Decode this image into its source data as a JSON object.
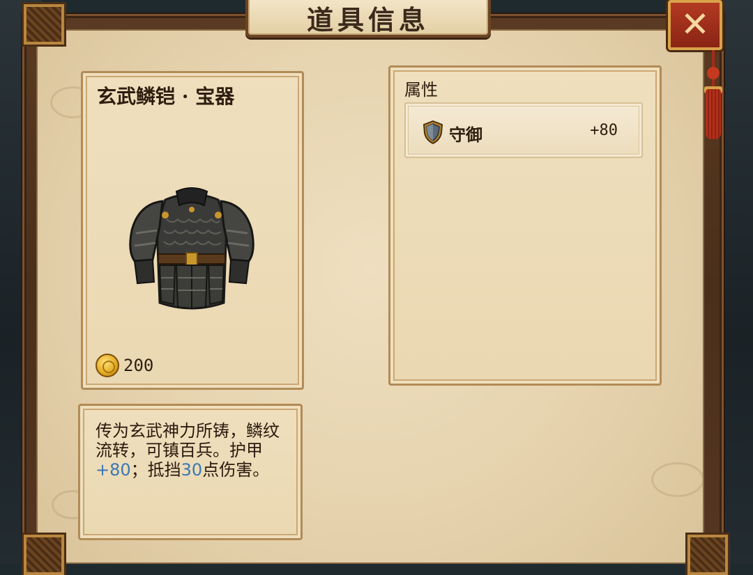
{
  "window": {
    "title": "道具信息",
    "close_label": "✕"
  },
  "item": {
    "name": "玄武鳞铠 · 宝器",
    "image_icon": "armor-icon",
    "price_icon": "gold-coin-icon",
    "price": "200"
  },
  "description": {
    "part1": "传为玄武神力所铸，鳞纹流转，可镇百兵。护甲",
    "armor_value": "+80",
    "part2": "；抵挡",
    "block_value": "30",
    "part3": "点伤害。"
  },
  "attributes": {
    "title": "属性",
    "items": [
      {
        "icon": "shield-icon",
        "name": "守御",
        "value": "+80"
      }
    ]
  },
  "colors": {
    "highlight": "#3a78b5",
    "close_button": "#b33a22",
    "parchment": "#e6d3ae"
  }
}
